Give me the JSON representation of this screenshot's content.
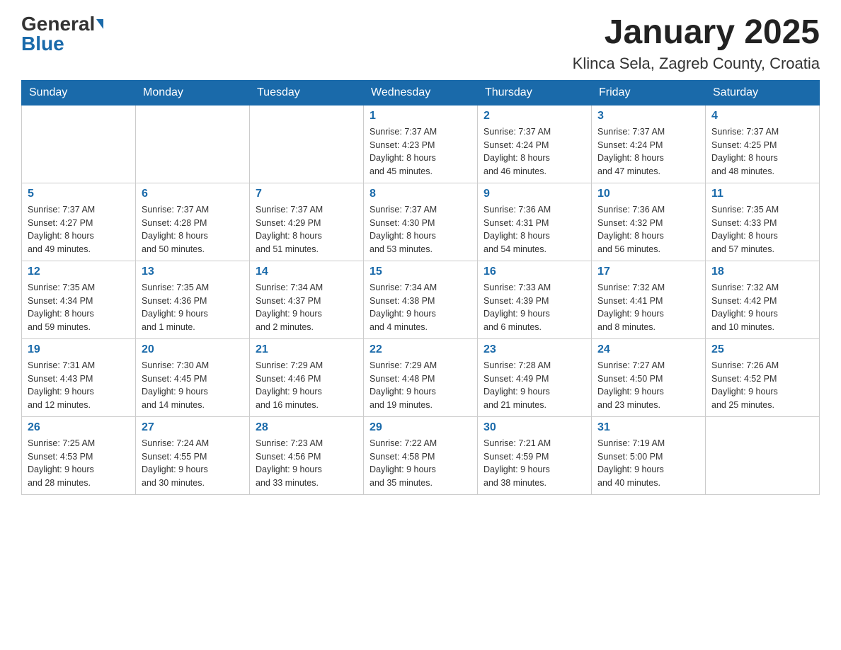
{
  "header": {
    "logo_general": "General",
    "logo_blue": "Blue",
    "month_title": "January 2025",
    "location": "Klinca Sela, Zagreb County, Croatia"
  },
  "weekdays": [
    "Sunday",
    "Monday",
    "Tuesday",
    "Wednesday",
    "Thursday",
    "Friday",
    "Saturday"
  ],
  "weeks": [
    [
      {
        "day": "",
        "info": ""
      },
      {
        "day": "",
        "info": ""
      },
      {
        "day": "",
        "info": ""
      },
      {
        "day": "1",
        "info": "Sunrise: 7:37 AM\nSunset: 4:23 PM\nDaylight: 8 hours\nand 45 minutes."
      },
      {
        "day": "2",
        "info": "Sunrise: 7:37 AM\nSunset: 4:24 PM\nDaylight: 8 hours\nand 46 minutes."
      },
      {
        "day": "3",
        "info": "Sunrise: 7:37 AM\nSunset: 4:24 PM\nDaylight: 8 hours\nand 47 minutes."
      },
      {
        "day": "4",
        "info": "Sunrise: 7:37 AM\nSunset: 4:25 PM\nDaylight: 8 hours\nand 48 minutes."
      }
    ],
    [
      {
        "day": "5",
        "info": "Sunrise: 7:37 AM\nSunset: 4:27 PM\nDaylight: 8 hours\nand 49 minutes."
      },
      {
        "day": "6",
        "info": "Sunrise: 7:37 AM\nSunset: 4:28 PM\nDaylight: 8 hours\nand 50 minutes."
      },
      {
        "day": "7",
        "info": "Sunrise: 7:37 AM\nSunset: 4:29 PM\nDaylight: 8 hours\nand 51 minutes."
      },
      {
        "day": "8",
        "info": "Sunrise: 7:37 AM\nSunset: 4:30 PM\nDaylight: 8 hours\nand 53 minutes."
      },
      {
        "day": "9",
        "info": "Sunrise: 7:36 AM\nSunset: 4:31 PM\nDaylight: 8 hours\nand 54 minutes."
      },
      {
        "day": "10",
        "info": "Sunrise: 7:36 AM\nSunset: 4:32 PM\nDaylight: 8 hours\nand 56 minutes."
      },
      {
        "day": "11",
        "info": "Sunrise: 7:35 AM\nSunset: 4:33 PM\nDaylight: 8 hours\nand 57 minutes."
      }
    ],
    [
      {
        "day": "12",
        "info": "Sunrise: 7:35 AM\nSunset: 4:34 PM\nDaylight: 8 hours\nand 59 minutes."
      },
      {
        "day": "13",
        "info": "Sunrise: 7:35 AM\nSunset: 4:36 PM\nDaylight: 9 hours\nand 1 minute."
      },
      {
        "day": "14",
        "info": "Sunrise: 7:34 AM\nSunset: 4:37 PM\nDaylight: 9 hours\nand 2 minutes."
      },
      {
        "day": "15",
        "info": "Sunrise: 7:34 AM\nSunset: 4:38 PM\nDaylight: 9 hours\nand 4 minutes."
      },
      {
        "day": "16",
        "info": "Sunrise: 7:33 AM\nSunset: 4:39 PM\nDaylight: 9 hours\nand 6 minutes."
      },
      {
        "day": "17",
        "info": "Sunrise: 7:32 AM\nSunset: 4:41 PM\nDaylight: 9 hours\nand 8 minutes."
      },
      {
        "day": "18",
        "info": "Sunrise: 7:32 AM\nSunset: 4:42 PM\nDaylight: 9 hours\nand 10 minutes."
      }
    ],
    [
      {
        "day": "19",
        "info": "Sunrise: 7:31 AM\nSunset: 4:43 PM\nDaylight: 9 hours\nand 12 minutes."
      },
      {
        "day": "20",
        "info": "Sunrise: 7:30 AM\nSunset: 4:45 PM\nDaylight: 9 hours\nand 14 minutes."
      },
      {
        "day": "21",
        "info": "Sunrise: 7:29 AM\nSunset: 4:46 PM\nDaylight: 9 hours\nand 16 minutes."
      },
      {
        "day": "22",
        "info": "Sunrise: 7:29 AM\nSunset: 4:48 PM\nDaylight: 9 hours\nand 19 minutes."
      },
      {
        "day": "23",
        "info": "Sunrise: 7:28 AM\nSunset: 4:49 PM\nDaylight: 9 hours\nand 21 minutes."
      },
      {
        "day": "24",
        "info": "Sunrise: 7:27 AM\nSunset: 4:50 PM\nDaylight: 9 hours\nand 23 minutes."
      },
      {
        "day": "25",
        "info": "Sunrise: 7:26 AM\nSunset: 4:52 PM\nDaylight: 9 hours\nand 25 minutes."
      }
    ],
    [
      {
        "day": "26",
        "info": "Sunrise: 7:25 AM\nSunset: 4:53 PM\nDaylight: 9 hours\nand 28 minutes."
      },
      {
        "day": "27",
        "info": "Sunrise: 7:24 AM\nSunset: 4:55 PM\nDaylight: 9 hours\nand 30 minutes."
      },
      {
        "day": "28",
        "info": "Sunrise: 7:23 AM\nSunset: 4:56 PM\nDaylight: 9 hours\nand 33 minutes."
      },
      {
        "day": "29",
        "info": "Sunrise: 7:22 AM\nSunset: 4:58 PM\nDaylight: 9 hours\nand 35 minutes."
      },
      {
        "day": "30",
        "info": "Sunrise: 7:21 AM\nSunset: 4:59 PM\nDaylight: 9 hours\nand 38 minutes."
      },
      {
        "day": "31",
        "info": "Sunrise: 7:19 AM\nSunset: 5:00 PM\nDaylight: 9 hours\nand 40 minutes."
      },
      {
        "day": "",
        "info": ""
      }
    ]
  ]
}
